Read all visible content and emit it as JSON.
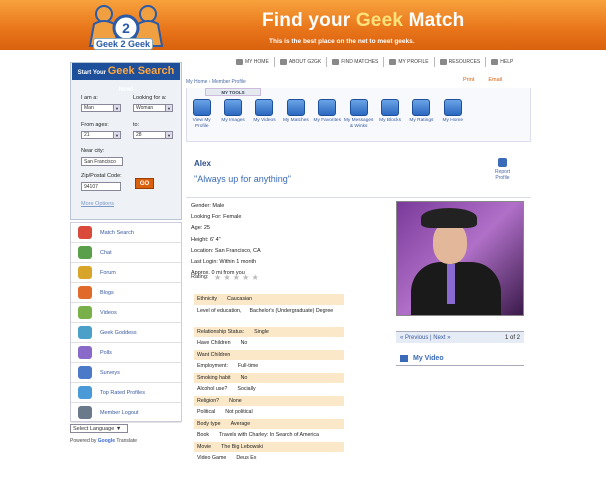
{
  "header": {
    "title_a": "Find your ",
    "title_b": "Geek",
    "title_c": " Match",
    "subtitle": "This is the best place on the net to meet geeks.",
    "logo_text": "Geek 2 Geek"
  },
  "topnav": [
    "MY HOME",
    "ABOUT G2GK",
    "FIND MATCHES",
    "MY PROFILE",
    "RESOURCES",
    "HELP"
  ],
  "search": {
    "head_small_a": "Start Your ",
    "head_big": "Geek Search",
    "head_small_b": " Now!",
    "i_am_label": "I am a:",
    "i_am_value": "Man",
    "looking_label": "Looking for a:",
    "looking_value": "Woman",
    "from_label": "From ages:",
    "from_value": "21",
    "to_label": "to:",
    "to_value": "28",
    "city_label": "Near city:",
    "city_value": "San Francisco",
    "zip_label": "Zip/Postal Code:",
    "zip_value": "94107",
    "go_label": "GO",
    "more_label": "More Options"
  },
  "sidebar": {
    "items": [
      {
        "label": "Match Search",
        "color": "#d94a3a"
      },
      {
        "label": "Chat",
        "color": "#5aa04a"
      },
      {
        "label": "Forum",
        "color": "#d9a42a"
      },
      {
        "label": "Blogs",
        "color": "#e06a2a"
      },
      {
        "label": "Videos",
        "color": "#7ab04a"
      },
      {
        "label": "Geek Goddess",
        "color": "#4aa0c8"
      },
      {
        "label": "Polls",
        "color": "#8a6ac8"
      },
      {
        "label": "Surveys",
        "color": "#4a7ac8"
      },
      {
        "label": "Top Rated Profiles",
        "color": "#4a9ad8"
      },
      {
        "label": "Member Logout",
        "color": "#6a7a8a"
      }
    ]
  },
  "language": {
    "value": "Select Language"
  },
  "powered": {
    "text": "Powered by ",
    "brand": "Google",
    "suffix": " Translate"
  },
  "breadcrumb": "My Home  ›  Member Profile",
  "actions": {
    "print": "Print",
    "email": "Email"
  },
  "tools": {
    "tab": "MY TOOLS",
    "items": [
      "View My Profile",
      "My Images",
      "My Videos",
      "My Matches",
      "My Favorites",
      "My Messages & Winks",
      "My Blocks",
      "My Ratings",
      "My Home"
    ]
  },
  "profile": {
    "name": "Alex",
    "tagline": "\"Always up for anything\"",
    "report": "Report Profile",
    "details": [
      "Gender: Male",
      "Looking For: Female",
      "Age: 25",
      "Height: 6' 4\"",
      "Location: San Francisco, CA",
      "Last Login: Within 1 month",
      "Approx. 0 mi from you"
    ],
    "rating_label": "Rating:",
    "stars": "★ ★ ★ ★ ★"
  },
  "pager": {
    "prev": "« Previous",
    "sep": "|",
    "next": "Next »",
    "count": "1 of 2"
  },
  "video": {
    "label": "My Video"
  },
  "attributes": [
    {
      "k": "Ethnicity",
      "v": "Caucasian",
      "shade": true
    },
    {
      "k": "Level of education,",
      "v": "Bachelor's (Undergraduate) Degree",
      "shade": false,
      "tall": true
    },
    {
      "k": "Relationship Status:",
      "v": "Single",
      "shade": true
    },
    {
      "k": "Have Children",
      "v": "No",
      "shade": false
    },
    {
      "k": "Want Children",
      "v": "",
      "shade": true
    },
    {
      "k": "Employment:",
      "v": "Full-time",
      "shade": false
    },
    {
      "k": "Smoking habit",
      "v": "No",
      "shade": true
    },
    {
      "k": "Alcohol use?",
      "v": "Socially",
      "shade": false
    },
    {
      "k": "Religion?",
      "v": "None",
      "shade": true
    },
    {
      "k": "Political",
      "v": "Not political",
      "shade": false
    },
    {
      "k": "Body type",
      "v": "Average",
      "shade": true
    },
    {
      "k": "Book",
      "v": "Travels with Charley: In Search of America",
      "shade": false
    },
    {
      "k": "Movie",
      "v": "The Big Lebowski",
      "shade": true
    },
    {
      "k": "Video Game",
      "v": "Deus Ex",
      "shade": false
    }
  ]
}
